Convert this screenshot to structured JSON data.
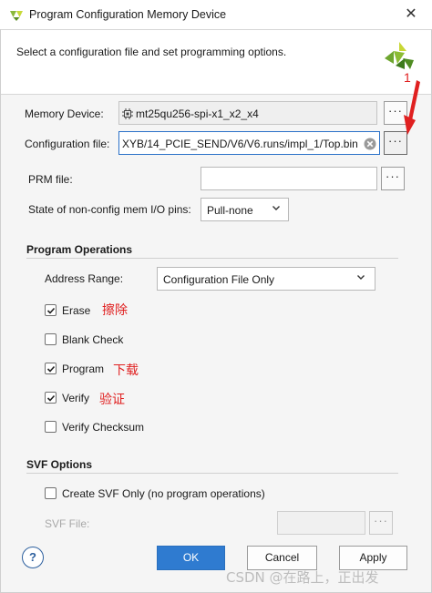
{
  "window": {
    "title": "Program Configuration Memory Device",
    "close_glyph": "✕"
  },
  "header": {
    "instruction": "Select a configuration file and set programming options.",
    "logo_icon": "xilinx-logo-icon",
    "annotation_number": "1"
  },
  "form": {
    "memory_device": {
      "label": "Memory Device:",
      "value": "mt25qu256-spi-x1_x2_x4",
      "icon": "chip-icon",
      "browse_label": "···"
    },
    "configuration_file": {
      "label": "Configuration file:",
      "value": "XYB/14_PCIE_SEND/V6/V6.runs/impl_1/Top.bin",
      "clear_icon": "clear-icon",
      "browse_label": "···"
    },
    "prm_file": {
      "label": "PRM file:",
      "value": "",
      "browse_label": "···"
    },
    "non_config_pins": {
      "label": "State of non-config mem I/O pins:",
      "selected": "Pull-none"
    }
  },
  "program_operations": {
    "title": "Program Operations",
    "address_range": {
      "label": "Address Range:",
      "selected": "Configuration File Only"
    },
    "options": [
      {
        "label": "Erase",
        "checked": true,
        "note": "擦除"
      },
      {
        "label": "Blank Check",
        "checked": false,
        "note": ""
      },
      {
        "label": "Program",
        "checked": true,
        "note": "下载"
      },
      {
        "label": "Verify",
        "checked": true,
        "note": "验证"
      },
      {
        "label": "Verify Checksum",
        "checked": false,
        "note": ""
      }
    ]
  },
  "svf_options": {
    "title": "SVF Options",
    "create_svf_only": {
      "label": "Create SVF Only (no program operations)",
      "checked": false
    },
    "svf_file": {
      "label": "SVF File:",
      "value": "",
      "browse_label": "···"
    }
  },
  "footer": {
    "help_label": "?",
    "ok_label": "OK",
    "cancel_label": "Cancel",
    "apply_label": "Apply"
  },
  "watermark": "CSDN @在路上，正出发",
  "colors": {
    "primary_button": "#2f7bd0",
    "annotation_red": "#e02020",
    "focus_border": "#2b71c8"
  }
}
